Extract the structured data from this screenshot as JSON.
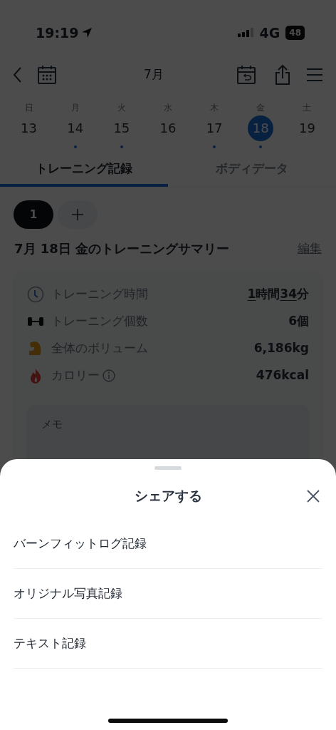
{
  "status_bar": {
    "time": "19:19",
    "network": "4G",
    "battery": "48"
  },
  "nav": {
    "title": "7月"
  },
  "week": [
    {
      "weekday": "日",
      "date": "13",
      "has_record": false,
      "selected": false
    },
    {
      "weekday": "月",
      "date": "14",
      "has_record": true,
      "selected": false
    },
    {
      "weekday": "火",
      "date": "15",
      "has_record": true,
      "selected": false
    },
    {
      "weekday": "水",
      "date": "16",
      "has_record": false,
      "selected": false
    },
    {
      "weekday": "木",
      "date": "17",
      "has_record": true,
      "selected": false
    },
    {
      "weekday": "金",
      "date": "18",
      "has_record": true,
      "selected": true
    },
    {
      "weekday": "土",
      "date": "19",
      "has_record": false,
      "selected": false
    }
  ],
  "tabs": [
    {
      "label": "トレーニング記録",
      "selected": true
    },
    {
      "label": "ボディデータ",
      "selected": false
    }
  ],
  "sessions": [
    {
      "label": "1",
      "selected": true
    }
  ],
  "summary": {
    "title": "7月 18日 金のトレーニングサマリー",
    "edit": "編集",
    "stats": [
      {
        "kind": "time",
        "label": "トレーニング時間",
        "value_parts": [
          {
            "text": "1",
            "underline": true
          },
          {
            "text": "時間",
            "underline": false
          },
          {
            "text": "34",
            "underline": true
          },
          {
            "text": "分",
            "underline": false
          }
        ]
      },
      {
        "kind": "count",
        "label": "トレーニング個数",
        "value_parts": [
          {
            "text": "6",
            "underline": false
          },
          {
            "text": "個",
            "underline": false
          }
        ]
      },
      {
        "kind": "volume",
        "label": "全体のボリューム",
        "value_parts": [
          {
            "text": "6,186kg",
            "underline": false
          }
        ]
      },
      {
        "kind": "calorie",
        "label": "カロリー",
        "info": true,
        "value_parts": [
          {
            "text": "476kcal",
            "underline": false
          }
        ]
      }
    ],
    "memo_label": "メモ"
  },
  "share_sheet": {
    "title": "シェアする",
    "options": [
      "バーンフィットログ記録",
      "オリジナル写真記録",
      "テキスト記録"
    ]
  }
}
